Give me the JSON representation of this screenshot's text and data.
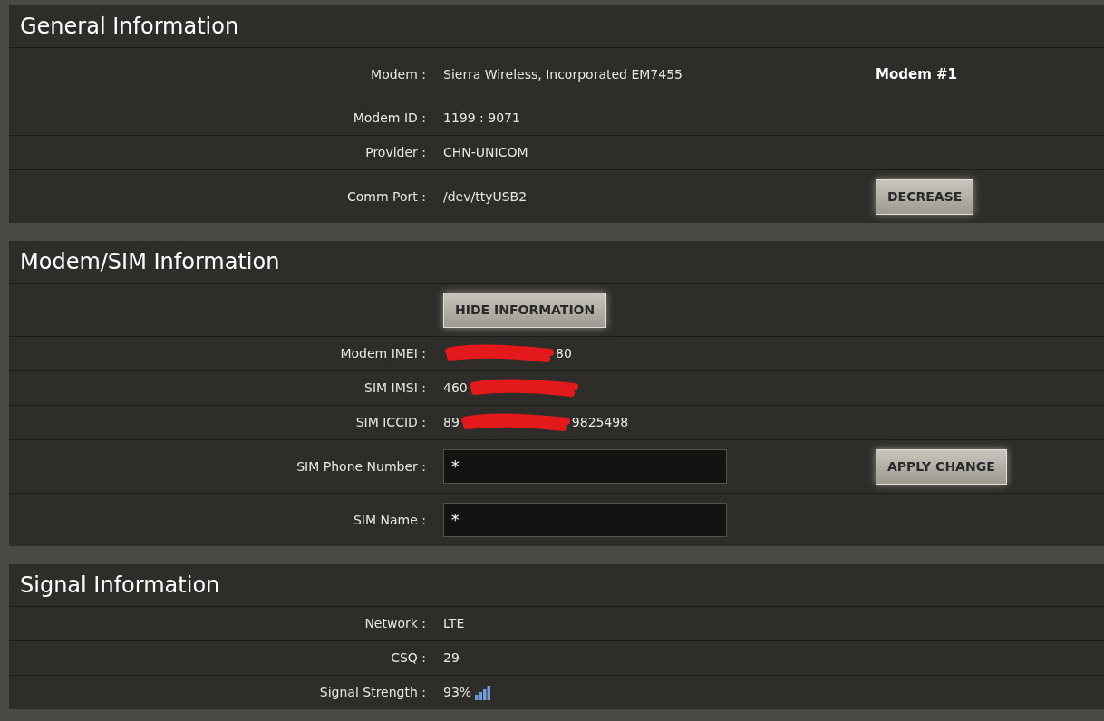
{
  "sections": [
    {
      "title": "General Information",
      "rows": [
        {
          "kind": "text",
          "label": "Modem :",
          "value": "Sierra Wireless, Incorporated EM7455",
          "extra": {
            "kind": "heading",
            "text": "Modem #1"
          }
        },
        {
          "kind": "text",
          "label": "Modem ID :",
          "value": "1199 : 9071"
        },
        {
          "kind": "text",
          "label": "Provider :",
          "value": "CHN-UNICOM"
        },
        {
          "kind": "text",
          "label": "Comm Port :",
          "value": "/dev/ttyUSB2",
          "extra": {
            "kind": "button",
            "text": "DECREASE"
          }
        }
      ]
    },
    {
      "title": "Modem/SIM Information",
      "rows": [
        {
          "kind": "button",
          "text": "HIDE INFORMATION"
        },
        {
          "kind": "redacted",
          "label": "Modem IMEI :",
          "prefix": "",
          "suffix": "80"
        },
        {
          "kind": "redacted",
          "label": "SIM IMSI :",
          "prefix": "460",
          "suffix": ""
        },
        {
          "kind": "redacted",
          "label": "SIM ICCID :",
          "prefix": "89",
          "suffix": "9825498"
        },
        {
          "kind": "input",
          "label": "SIM Phone Number :",
          "value": "*",
          "extra": {
            "kind": "button",
            "text": "APPLY CHANGE"
          }
        },
        {
          "kind": "input",
          "label": "SIM Name :",
          "value": "*"
        }
      ]
    },
    {
      "title": "Signal Information",
      "rows": [
        {
          "kind": "text",
          "label": "Network :",
          "value": "LTE"
        },
        {
          "kind": "text",
          "label": "CSQ :",
          "value": "29"
        },
        {
          "kind": "signal",
          "label": "Signal Strength :",
          "value": "93%"
        }
      ]
    }
  ]
}
